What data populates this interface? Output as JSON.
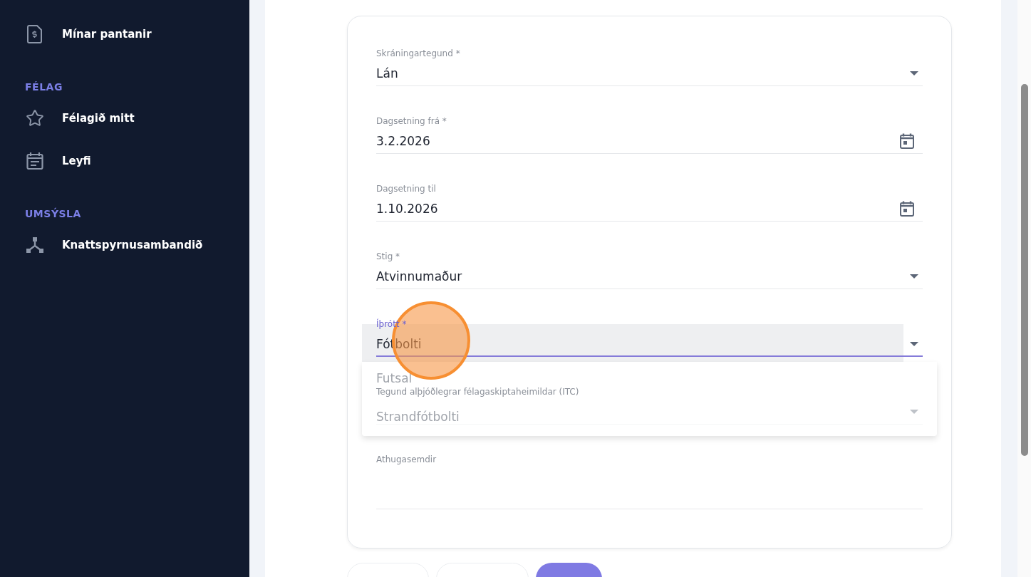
{
  "sidebar": {
    "sections": [
      {
        "items": [
          {
            "label": "Mínar pantanir",
            "kind": "invoice"
          }
        ]
      },
      {
        "heading": "FÉLAG",
        "items": [
          {
            "label": "Félagið mitt",
            "kind": "star"
          },
          {
            "label": "Leyfi",
            "kind": "calendar"
          }
        ]
      },
      {
        "heading": "UMSÝSLA",
        "items": [
          {
            "label": "Knattspyrnusambandið",
            "kind": "network"
          }
        ]
      }
    ]
  },
  "form": {
    "fields": [
      {
        "kind": "select",
        "label": "Skráningartegund *",
        "value": "Lán",
        "focused": false
      },
      {
        "kind": "date",
        "label": "Dagsetning frá *",
        "value": "3.2.2026",
        "focused": false
      },
      {
        "kind": "date",
        "label": "Dagsetning til",
        "value": "1.10.2026",
        "focused": false
      },
      {
        "kind": "select",
        "label": "Stig *",
        "value": "Atvinnumaður",
        "focused": false
      },
      {
        "kind": "select",
        "label": "Íþrótt *",
        "value": "Fótbolti",
        "focused": true,
        "menu": [
          {
            "label": "Futsal"
          },
          {
            "label": "Strandfótbolti"
          }
        ],
        "click_marker": true
      },
      {
        "kind": "select",
        "label": "Tegund alþjóðlegrar félagaskiptaheimildar (ITC)",
        "focused": false
      },
      {
        "kind": "textarea",
        "label": "Athugasemdir",
        "focused": false
      }
    ]
  },
  "buttons": [
    {
      "kind": "outlined"
    },
    {
      "kind": "outlined"
    },
    {
      "kind": "filled"
    }
  ]
}
